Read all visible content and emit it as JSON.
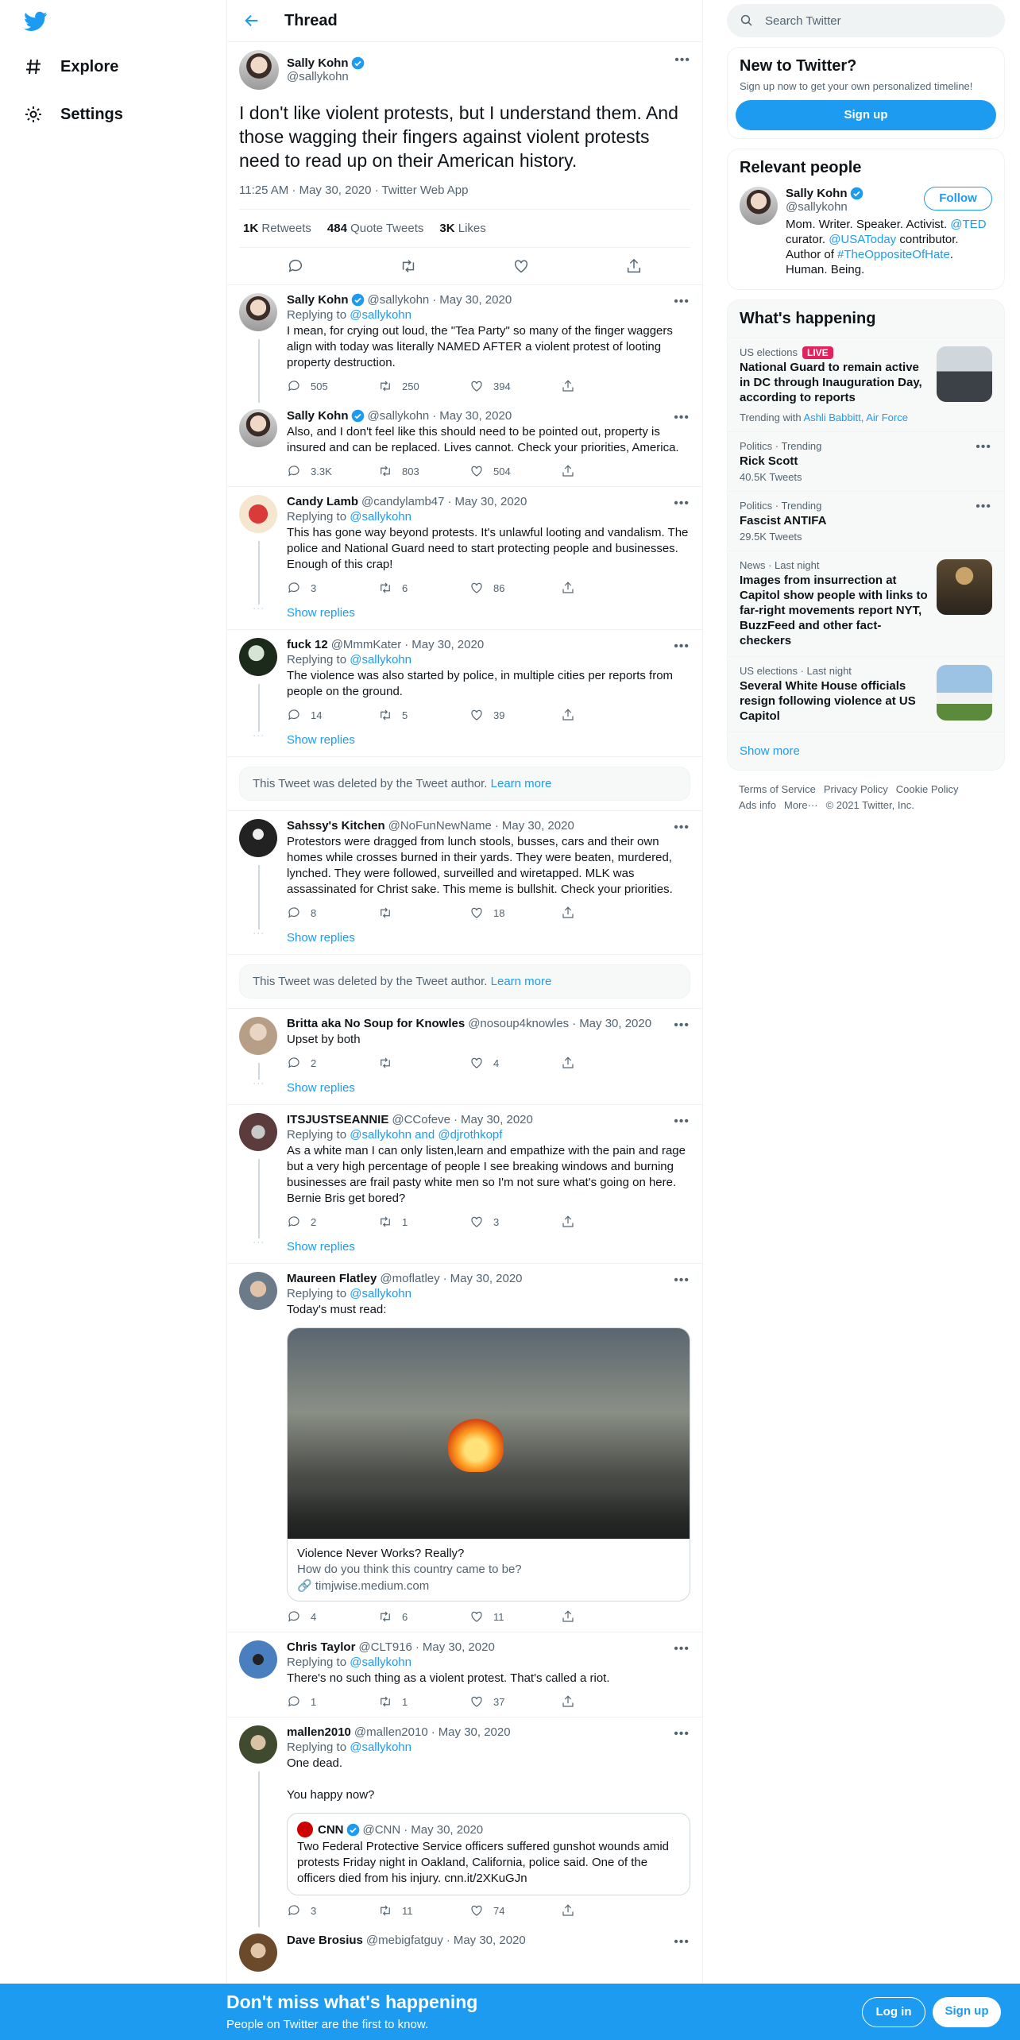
{
  "nav": {
    "explore": "Explore",
    "settings": "Settings"
  },
  "header": {
    "title": "Thread"
  },
  "focal": {
    "name": "Sally Kohn",
    "handle": "@sallykohn",
    "text": "I don't like violent protests, but I understand them.  And those wagging their fingers against violent protests need to read up on their American history.",
    "meta": "11:25 AM · May 30, 2020 · Twitter Web App",
    "retweets": "1K",
    "retweets_label": "Retweets",
    "quotes": "484",
    "quotes_label": "Quote Tweets",
    "likes": "3K",
    "likes_label": "Likes"
  },
  "tweets": [
    {
      "name": "Sally Kohn",
      "handle": "@sallykohn",
      "date": "May 30, 2020",
      "replying": "@sallykohn",
      "text": "I mean, for crying out loud, the \"Tea Party\" so many of the finger waggers align with today was literally NAMED AFTER a violent protest of looting property destruction.",
      "replies": "505",
      "rts": "250",
      "likes": "394"
    },
    {
      "name": "Sally Kohn",
      "handle": "@sallykohn",
      "date": "May 30, 2020",
      "text": "Also, and I don't feel like this should need to be pointed out, property is insured and can be replaced.  Lives cannot.  Check your priorities, America.",
      "replies": "3.3K",
      "rts": "803",
      "likes": "504"
    },
    {
      "name": "Candy Lamb",
      "handle": "@candylamb47",
      "date": "May 30, 2020",
      "replying": "@sallykohn",
      "text": "This has gone way beyond protests. It's unlawful looting and vandalism. The police and National Guard need to start protecting people and businesses. Enough of this crap!",
      "replies": "3",
      "rts": "6",
      "likes": "86"
    },
    {
      "name": "fuck 12",
      "handle": "@MmmKater",
      "date": "May 30, 2020",
      "replying": "@sallykohn",
      "text": "The violence was also started by police, in multiple cities per reports from people on the ground.",
      "replies": "14",
      "rts": "5",
      "likes": "39"
    },
    {
      "name": "Sahssy's Kitchen",
      "handle": "@NoFunNewName",
      "date": "May 30, 2020",
      "text": "Protestors were dragged from lunch stools, busses, cars and their own homes while crosses burned in their yards. They were beaten, murdered, lynched. They were followed, surveilled and wiretapped. MLK was assassinated for Christ sake. This meme is bullshit. Check your priorities.",
      "replies": "8",
      "rts": "",
      "likes": "18"
    },
    {
      "name": "Britta aka No Soup for Knowles",
      "handle": "@nosoup4knowles",
      "date": "May 30, 2020",
      "text": "Upset by both",
      "replies": "2",
      "rts": "",
      "likes": "4"
    },
    {
      "name": "ITSJUSTSEANNIE",
      "handle": "@CCofeve",
      "date": "May 30, 2020",
      "replying": "@sallykohn and @djrothkopf",
      "text": "As a white man I can only listen,learn and empathize with the pain and rage but a very high percentage of people I see breaking windows and burning businesses are frail pasty white men so I'm not sure what's going on here. Bernie Bris get bored?",
      "replies": "2",
      "rts": "1",
      "likes": "3"
    },
    {
      "name": "Maureen Flatley",
      "handle": "@moflatley",
      "date": "May 30, 2020",
      "replying": "@sallykohn",
      "text": "Today's must read:",
      "replies": "4",
      "rts": "6",
      "likes": "11"
    },
    {
      "name": "Chris Taylor",
      "handle": "@CLT916",
      "date": "May 30, 2020",
      "replying": "@sallykohn",
      "text": "There's no such thing as a violent protest. That's called a riot.",
      "replies": "1",
      "rts": "1",
      "likes": "37"
    },
    {
      "name": "mallen2010",
      "handle": "@mallen2010",
      "date": "May 30, 2020",
      "replying": "@sallykohn",
      "text": "One dead.",
      "text2": "You happy now?",
      "replies": "3",
      "rts": "11",
      "likes": "74"
    },
    {
      "name": "Dave Brosius",
      "handle": "@mebigfatguy",
      "date": "May 30, 2020"
    }
  ],
  "replying_prefix": "Replying to",
  "show_replies": "Show replies",
  "deleted_text": "This Tweet was deleted by the Tweet author.",
  "learn_more": "Learn more",
  "card": {
    "title": "Violence Never Works? Really?",
    "desc": "How do you think this country came to be?",
    "url": "timjwise.medium.com"
  },
  "quote": {
    "name": "CNN",
    "handle": "@CNN",
    "date": "May 30, 2020",
    "text": "Two Federal Protective Service officers suffered gunshot wounds amid protests Friday night in Oakland, California, police said. One of the officers died from his injury. cnn.it/2XKuGJn"
  },
  "sidebar": {
    "search_placeholder": "Search Twitter",
    "new_title": "New to Twitter?",
    "new_text": "Sign up now to get your own personalized timeline!",
    "signup": "Sign up",
    "relevant_title": "Relevant people",
    "rp_name": "Sally Kohn",
    "rp_handle": "@sallykohn",
    "follow": "Follow",
    "bio_1": "Mom. Writer. Speaker. Activist. ",
    "bio_ted": "@TED",
    "bio_2": " curator. ",
    "bio_usa": "@USAToday",
    "bio_3": " contributor. Author of ",
    "bio_tag": "#TheOppositeOfHate",
    "bio_4": ". Human. Being.",
    "happening_title": "What's happening",
    "trends": [
      {
        "cat": "US elections",
        "live": "LIVE",
        "name": "National Guard to remain active in DC through Inauguration Day, according to reports",
        "trending_with": "Trending with",
        "tw_links": "Ashli Babbitt, Air Force"
      },
      {
        "cat": "Politics · Trending",
        "name": "Rick Scott",
        "count": "40.5K Tweets"
      },
      {
        "cat": "Politics · Trending",
        "name": "Fascist ANTIFA",
        "count": "29.5K Tweets"
      },
      {
        "cat": "News · Last night",
        "name": "Images from insurrection at Capitol show people with links to far-right movements report NYT, BuzzFeed and other fact-checkers"
      },
      {
        "cat": "US elections · Last night",
        "name": "Several White House officials resign following violence at US Capitol"
      }
    ],
    "show_more": "Show more",
    "footer_1": [
      "Terms of Service",
      "Privacy Policy",
      "Cookie Policy"
    ],
    "footer_2": [
      "Ads info",
      "More···",
      "© 2021 Twitter, Inc."
    ]
  },
  "bottom_bar": {
    "title": "Don't miss what's happening",
    "subtitle": "People on Twitter are the first to know.",
    "login": "Log in",
    "signup": "Sign up"
  },
  "colors": {
    "accent": "#1d9bf0",
    "live": "#e0245e"
  }
}
